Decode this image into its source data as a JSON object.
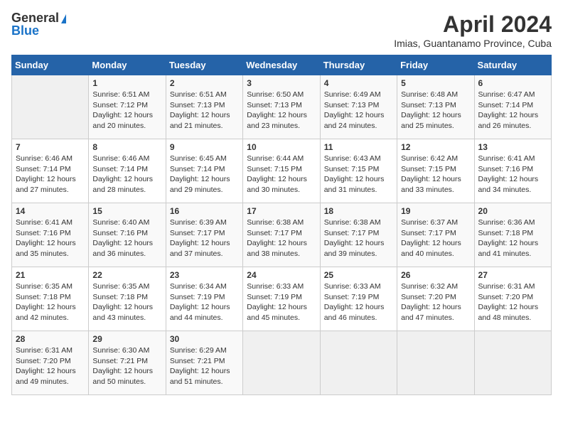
{
  "logo": {
    "general": "General",
    "blue": "Blue"
  },
  "header": {
    "month_title": "April 2024",
    "subtitle": "Imias, Guantanamo Province, Cuba"
  },
  "days_of_week": [
    "Sunday",
    "Monday",
    "Tuesday",
    "Wednesday",
    "Thursday",
    "Friday",
    "Saturday"
  ],
  "weeks": [
    [
      {
        "day": "",
        "info": ""
      },
      {
        "day": "1",
        "info": "Sunrise: 6:51 AM\nSunset: 7:12 PM\nDaylight: 12 hours\nand 20 minutes."
      },
      {
        "day": "2",
        "info": "Sunrise: 6:51 AM\nSunset: 7:13 PM\nDaylight: 12 hours\nand 21 minutes."
      },
      {
        "day": "3",
        "info": "Sunrise: 6:50 AM\nSunset: 7:13 PM\nDaylight: 12 hours\nand 23 minutes."
      },
      {
        "day": "4",
        "info": "Sunrise: 6:49 AM\nSunset: 7:13 PM\nDaylight: 12 hours\nand 24 minutes."
      },
      {
        "day": "5",
        "info": "Sunrise: 6:48 AM\nSunset: 7:13 PM\nDaylight: 12 hours\nand 25 minutes."
      },
      {
        "day": "6",
        "info": "Sunrise: 6:47 AM\nSunset: 7:14 PM\nDaylight: 12 hours\nand 26 minutes."
      }
    ],
    [
      {
        "day": "7",
        "info": "Sunrise: 6:46 AM\nSunset: 7:14 PM\nDaylight: 12 hours\nand 27 minutes."
      },
      {
        "day": "8",
        "info": "Sunrise: 6:46 AM\nSunset: 7:14 PM\nDaylight: 12 hours\nand 28 minutes."
      },
      {
        "day": "9",
        "info": "Sunrise: 6:45 AM\nSunset: 7:14 PM\nDaylight: 12 hours\nand 29 minutes."
      },
      {
        "day": "10",
        "info": "Sunrise: 6:44 AM\nSunset: 7:15 PM\nDaylight: 12 hours\nand 30 minutes."
      },
      {
        "day": "11",
        "info": "Sunrise: 6:43 AM\nSunset: 7:15 PM\nDaylight: 12 hours\nand 31 minutes."
      },
      {
        "day": "12",
        "info": "Sunrise: 6:42 AM\nSunset: 7:15 PM\nDaylight: 12 hours\nand 33 minutes."
      },
      {
        "day": "13",
        "info": "Sunrise: 6:41 AM\nSunset: 7:16 PM\nDaylight: 12 hours\nand 34 minutes."
      }
    ],
    [
      {
        "day": "14",
        "info": "Sunrise: 6:41 AM\nSunset: 7:16 PM\nDaylight: 12 hours\nand 35 minutes."
      },
      {
        "day": "15",
        "info": "Sunrise: 6:40 AM\nSunset: 7:16 PM\nDaylight: 12 hours\nand 36 minutes."
      },
      {
        "day": "16",
        "info": "Sunrise: 6:39 AM\nSunset: 7:17 PM\nDaylight: 12 hours\nand 37 minutes."
      },
      {
        "day": "17",
        "info": "Sunrise: 6:38 AM\nSunset: 7:17 PM\nDaylight: 12 hours\nand 38 minutes."
      },
      {
        "day": "18",
        "info": "Sunrise: 6:38 AM\nSunset: 7:17 PM\nDaylight: 12 hours\nand 39 minutes."
      },
      {
        "day": "19",
        "info": "Sunrise: 6:37 AM\nSunset: 7:17 PM\nDaylight: 12 hours\nand 40 minutes."
      },
      {
        "day": "20",
        "info": "Sunrise: 6:36 AM\nSunset: 7:18 PM\nDaylight: 12 hours\nand 41 minutes."
      }
    ],
    [
      {
        "day": "21",
        "info": "Sunrise: 6:35 AM\nSunset: 7:18 PM\nDaylight: 12 hours\nand 42 minutes."
      },
      {
        "day": "22",
        "info": "Sunrise: 6:35 AM\nSunset: 7:18 PM\nDaylight: 12 hours\nand 43 minutes."
      },
      {
        "day": "23",
        "info": "Sunrise: 6:34 AM\nSunset: 7:19 PM\nDaylight: 12 hours\nand 44 minutes."
      },
      {
        "day": "24",
        "info": "Sunrise: 6:33 AM\nSunset: 7:19 PM\nDaylight: 12 hours\nand 45 minutes."
      },
      {
        "day": "25",
        "info": "Sunrise: 6:33 AM\nSunset: 7:19 PM\nDaylight: 12 hours\nand 46 minutes."
      },
      {
        "day": "26",
        "info": "Sunrise: 6:32 AM\nSunset: 7:20 PM\nDaylight: 12 hours\nand 47 minutes."
      },
      {
        "day": "27",
        "info": "Sunrise: 6:31 AM\nSunset: 7:20 PM\nDaylight: 12 hours\nand 48 minutes."
      }
    ],
    [
      {
        "day": "28",
        "info": "Sunrise: 6:31 AM\nSunset: 7:20 PM\nDaylight: 12 hours\nand 49 minutes."
      },
      {
        "day": "29",
        "info": "Sunrise: 6:30 AM\nSunset: 7:21 PM\nDaylight: 12 hours\nand 50 minutes."
      },
      {
        "day": "30",
        "info": "Sunrise: 6:29 AM\nSunset: 7:21 PM\nDaylight: 12 hours\nand 51 minutes."
      },
      {
        "day": "",
        "info": ""
      },
      {
        "day": "",
        "info": ""
      },
      {
        "day": "",
        "info": ""
      },
      {
        "day": "",
        "info": ""
      }
    ]
  ]
}
